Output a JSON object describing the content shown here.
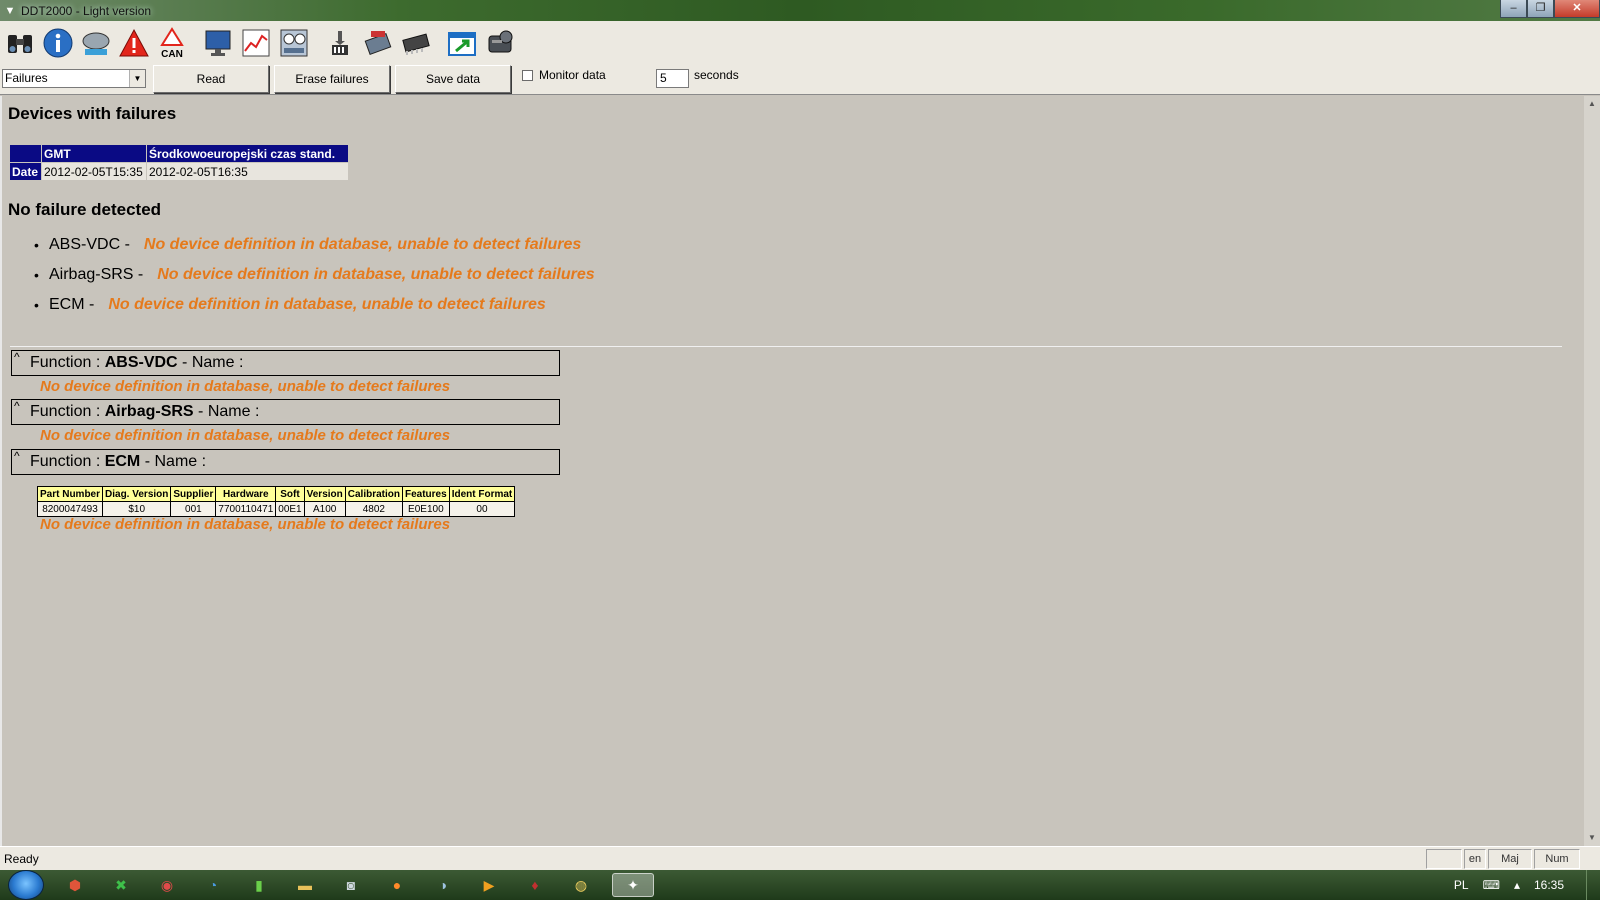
{
  "window": {
    "title": "DDT2000 - Light version",
    "min": "‒",
    "max": "❐",
    "close": "✕"
  },
  "toolbar": {
    "buttons": [
      "binoculars-icon",
      "info-icon",
      "ecu-icon",
      "warning-icon",
      "can-icon",
      "monitor-icon",
      "chart-icon",
      "dashboard-icon",
      "transfer-icon",
      "programming-icon",
      "chip-icon",
      "window-export-icon",
      "engine-icon"
    ],
    "can_label": "CAN"
  },
  "controls": {
    "mode_select": "Failures",
    "read_label": "Read",
    "erase_label": "Erase failures",
    "save_label": "Save data",
    "monitor_label": "Monitor data",
    "monitor_checked": false,
    "interval_value": "5",
    "seconds_label": "seconds"
  },
  "content": {
    "title": "Devices with failures",
    "date_table": {
      "headers": [
        "",
        "GMT",
        "Środkowoeuropejski czas stand."
      ],
      "row_label": "Date",
      "values": [
        "2012-02-05T15:35",
        "2012-02-05T16:35"
      ]
    },
    "no_failure_title": "No failure detected",
    "devices": [
      {
        "name": "ABS-VDC -",
        "msg": "No device definition in database, unable to detect failures"
      },
      {
        "name": "Airbag-SRS -",
        "msg": "No device definition in database, unable to detect failures"
      },
      {
        "name": "ECM -",
        "msg": "No device definition in database, unable to detect failures"
      }
    ],
    "functions": [
      {
        "prefix": "Function : ",
        "name": "ABS-VDC",
        "suffix": " - Name :",
        "msg": "No device definition in database, unable to detect failures"
      },
      {
        "prefix": "Function : ",
        "name": "Airbag-SRS",
        "suffix": " - Name :",
        "msg": "No device definition in database, unable to detect failures"
      },
      {
        "prefix": "Function : ",
        "name": "ECM",
        "suffix": " - Name :",
        "msg": "No device definition in database, unable to detect failures"
      }
    ],
    "ecm_table": {
      "headers": [
        "Part Number",
        "Diag. Version",
        "Supplier",
        "Hardware",
        "Soft",
        "Version",
        "Calibration",
        "Features",
        "Ident Format"
      ],
      "row": [
        "8200047493",
        "$10",
        "001",
        "7700110471",
        "00E1",
        "A100",
        "4802",
        "E0E100",
        "00"
      ]
    },
    "caret": "^"
  },
  "status": {
    "text": "Ready",
    "lang": "en",
    "caps": "Maj",
    "num": "Num"
  },
  "taskbar": {
    "lang": "PL",
    "time": "16:35"
  },
  "colors": {
    "header_bg": "#0a0a84",
    "warning_orange": "#e57a1c",
    "table_header_yellow": "#ffff99"
  }
}
